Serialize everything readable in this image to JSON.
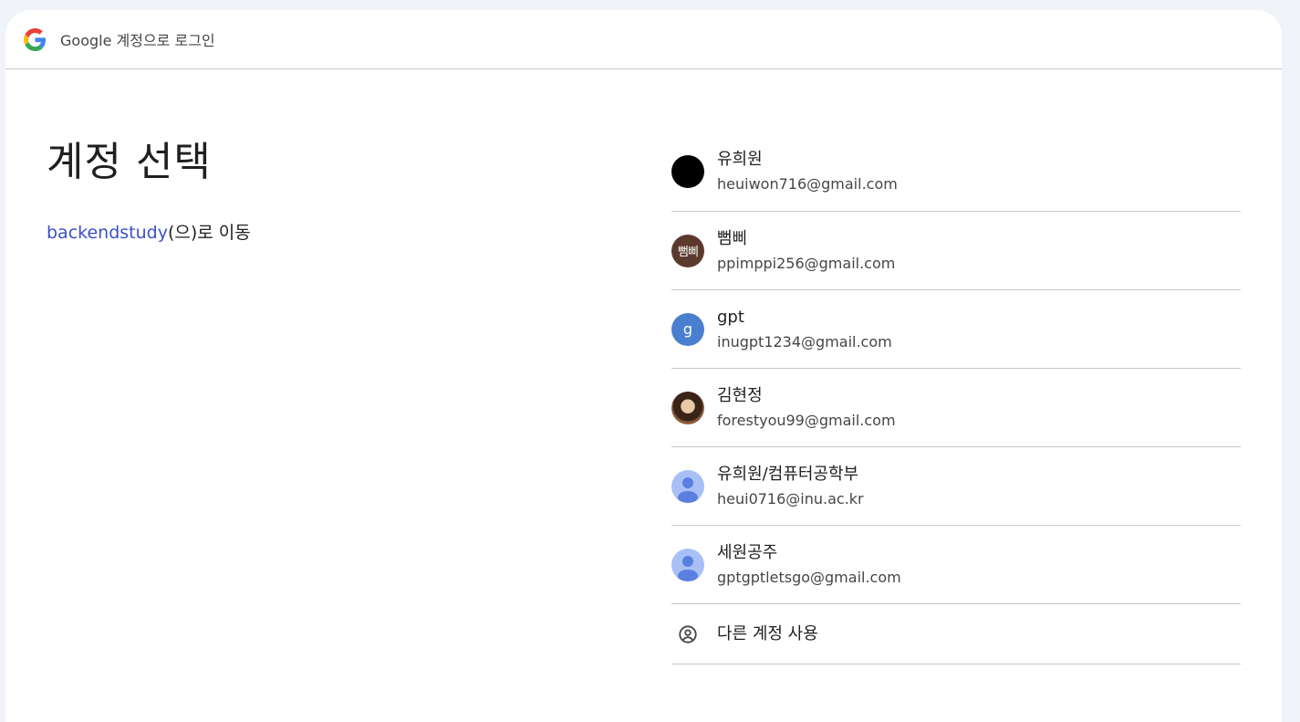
{
  "header": {
    "title": "Google 계정으로 로그인"
  },
  "main": {
    "title": "계정 선택",
    "app_name": "backendstudy",
    "subtitle_suffix": "(으)로 이동"
  },
  "accounts": [
    {
      "name": "유희원",
      "email": "heuiwon716@gmail.com",
      "avatar": "black-circle"
    },
    {
      "name": "뻠삐",
      "email": "ppimppi256@gmail.com",
      "avatar": "text",
      "avatar_text": "뻠삐"
    },
    {
      "name": "gpt",
      "email": "inugpt1234@gmail.com",
      "avatar": "letter",
      "avatar_text": "g"
    },
    {
      "name": "김현정",
      "email": "forestyou99@gmail.com",
      "avatar": "photo"
    },
    {
      "name": "유희원/컴퓨터공학부",
      "email": "heui0716@inu.ac.kr",
      "avatar": "default-person"
    },
    {
      "name": "세원공주",
      "email": "gptgptletsgo@gmail.com",
      "avatar": "default-person"
    }
  ],
  "use_other": {
    "label": "다른 계정 사용"
  },
  "colors": {
    "link": "#3b4fc7",
    "divider": "#c7c7c7",
    "background": "#f0f4f9"
  }
}
